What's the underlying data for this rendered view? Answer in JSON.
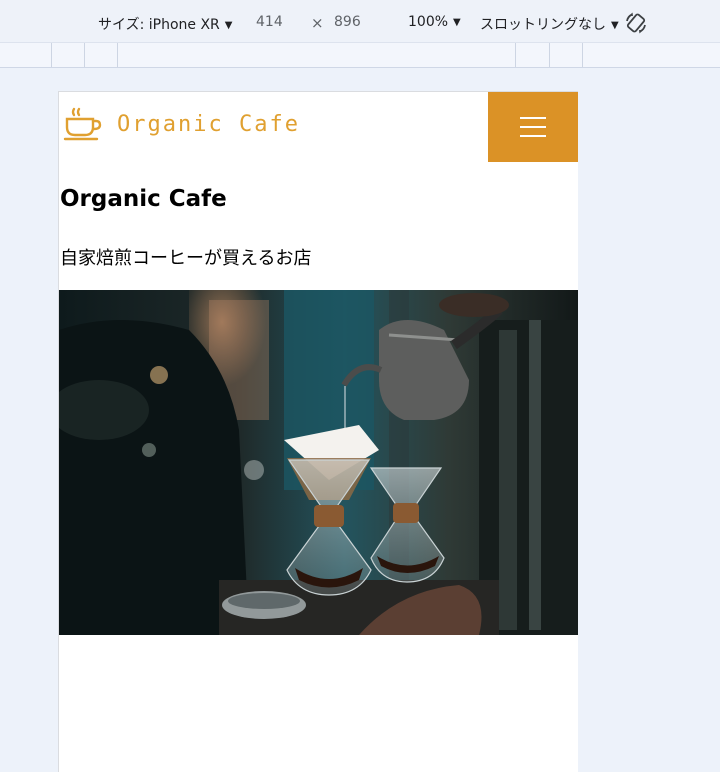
{
  "devtools": {
    "device_label": "サイズ: iPhone XR",
    "width": "414",
    "times": "×",
    "height": "896",
    "zoom": "100%",
    "throttle": "スロットリングなし",
    "rotate_icon": "rotate-icon"
  },
  "site": {
    "logo_text": "Organic Cafe",
    "logo_icon": "coffee-cup-icon",
    "menu_icon": "hamburger-icon",
    "title": "Organic Cafe",
    "subtitle": "自家焙煎コーヒーが買えるお店",
    "accent_color": "#db9226"
  }
}
